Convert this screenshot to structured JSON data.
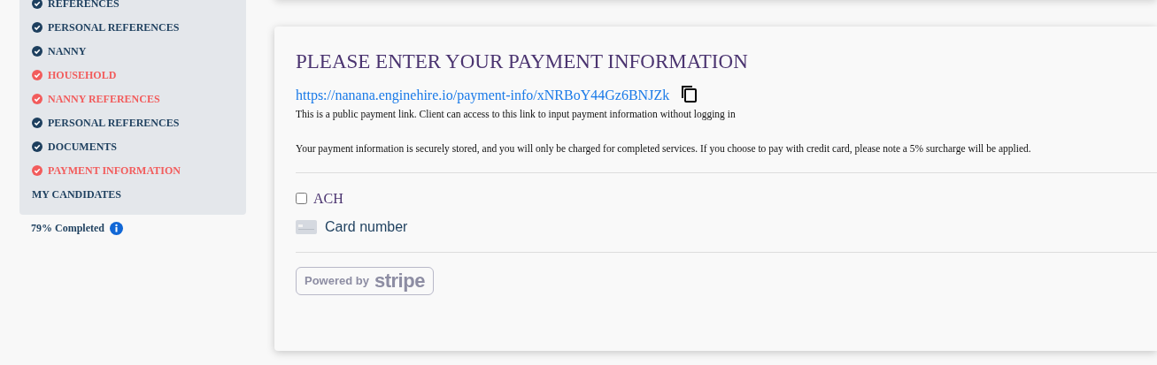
{
  "sidebar": {
    "items": [
      {
        "label": "REFERENCES",
        "done": true
      },
      {
        "label": "PERSONAL REFERENCES",
        "done": true
      },
      {
        "label": "NANNY",
        "done": true
      },
      {
        "label": "HOUSEHOLD",
        "done": false
      },
      {
        "label": "NANNY REFERENCES",
        "done": false
      },
      {
        "label": "PERSONAL REFERENCES",
        "done": true
      },
      {
        "label": "DOCUMENTS",
        "done": true
      },
      {
        "label": "PAYMENT INFORMATION",
        "done": false
      }
    ],
    "section": "MY CANDIDATES",
    "progress": "79% Completed"
  },
  "payment": {
    "title": "PLEASE ENTER YOUR PAYMENT INFORMATION",
    "link": "https://nanana.enginehire.io/payment-info/xNRBoY44Gz6BNJZk",
    "link_note": "This is a public payment link. Client can access to this link to input payment information without logging in",
    "notice": "Your payment information is securely stored, and you will only be charged for completed services. If you choose to pay with credit card, please note a 5% surcharge will be applied.",
    "ach": {
      "label": "ACH",
      "checked": false
    },
    "card_field": {
      "placeholder": "Card number"
    },
    "badge": {
      "prefix": "Powered by",
      "brand": "stripe"
    }
  }
}
